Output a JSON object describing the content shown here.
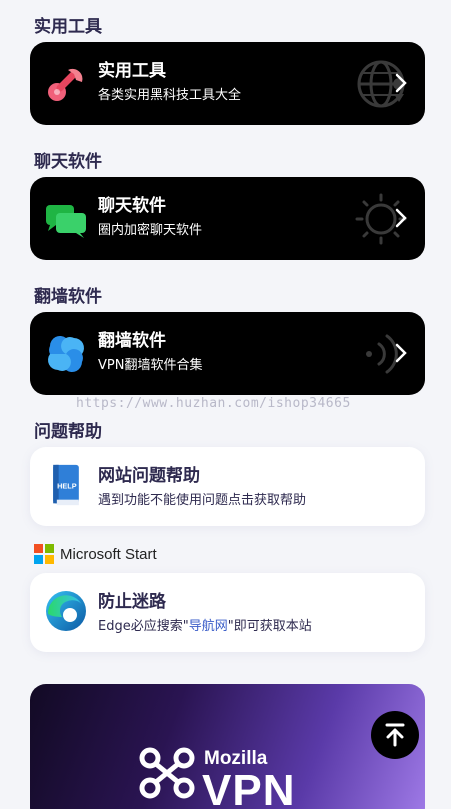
{
  "sections": {
    "tools": {
      "heading": "实用工具",
      "card_title": "实用工具",
      "card_subtitle": "各类实用黑科技工具大全",
      "icon": "wrench-icon",
      "deco": "globe-location-icon"
    },
    "chat": {
      "heading": "聊天软件",
      "card_title": "聊天软件",
      "card_subtitle": "圈内加密聊天软件",
      "icon": "chat-bubbles-icon",
      "deco": "sun-icon"
    },
    "vpn": {
      "heading": "翻墙软件",
      "card_title": "翻墙软件",
      "card_subtitle": "VPN翻墙软件合集",
      "icon": "clover-icon",
      "deco": "signal-waves-icon"
    },
    "help": {
      "heading": "问题帮助",
      "card_title": "网站问题帮助",
      "card_subtitle": "遇到功能不能使用问题点击获取帮助",
      "icon": "help-book-icon",
      "icon_text": "HELP"
    },
    "ms": {
      "brand": "Microsoft Start",
      "card_title": "防止迷路",
      "card_subtitle_before": "Edge必应搜索\"",
      "card_subtitle_link": "导航网",
      "card_subtitle_after": "\"即可获取本站",
      "icon": "edge-icon"
    }
  },
  "watermark": "https://www.huzhan.com/ishop34665",
  "banner": {
    "brand_small": "Mozilla",
    "brand_big": "VPN"
  },
  "back_to_top": {
    "icon": "arrow-up-to-top-icon"
  },
  "colors": {
    "page_bg": "#f4f5f9",
    "heading": "#2e2a4f",
    "dark_card": "#000000",
    "link": "#3a5dc8"
  }
}
